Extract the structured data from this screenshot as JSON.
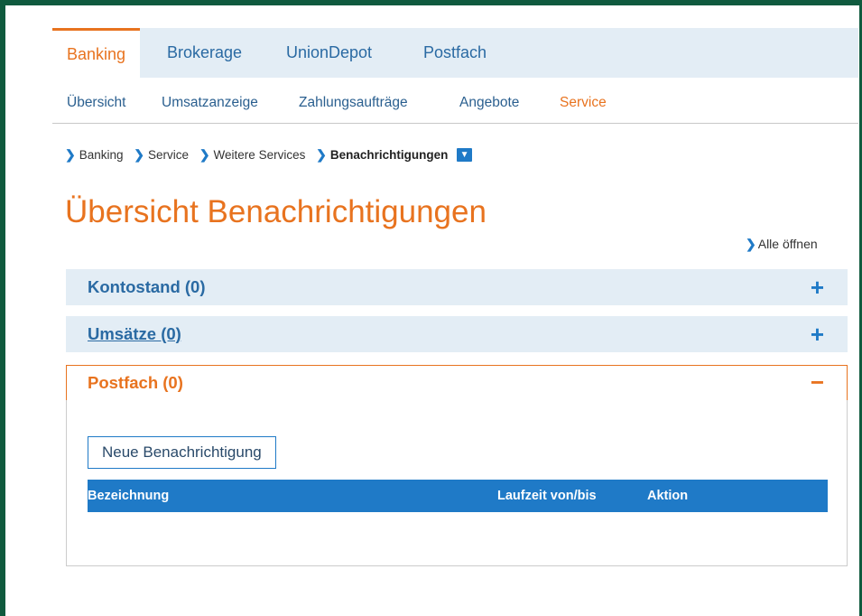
{
  "top_nav": {
    "tabs": [
      "Banking",
      "Brokerage",
      "UnionDepot",
      "Postfach"
    ]
  },
  "sub_nav": {
    "items": [
      "Übersicht",
      "Umsatzanzeige",
      "Zahlungsaufträge",
      "Angebote",
      "Service"
    ]
  },
  "breadcrumb": {
    "items": [
      "Banking",
      "Service",
      "Weitere Services",
      "Benachrichtigungen"
    ]
  },
  "page_title": "Übersicht Benachrichtigungen",
  "expand_all_label": "Alle öffnen",
  "sections": [
    {
      "label": "Kontostand (0)",
      "sign": "+"
    },
    {
      "label": "Umsätze (0)",
      "sign": "+"
    },
    {
      "label": "Postfach (0)",
      "sign": "−"
    }
  ],
  "postfach": {
    "new_button_label": "Neue Benachrichtigung",
    "table_columns": [
      "Bezeichnung",
      "Laufzeit von/bis",
      "Aktion"
    ]
  },
  "colors": {
    "accent_orange": "#e8731f",
    "accent_blue": "#1f7ac7",
    "nav_background": "#e3edf5",
    "frame_green": "#0f5a3e"
  }
}
